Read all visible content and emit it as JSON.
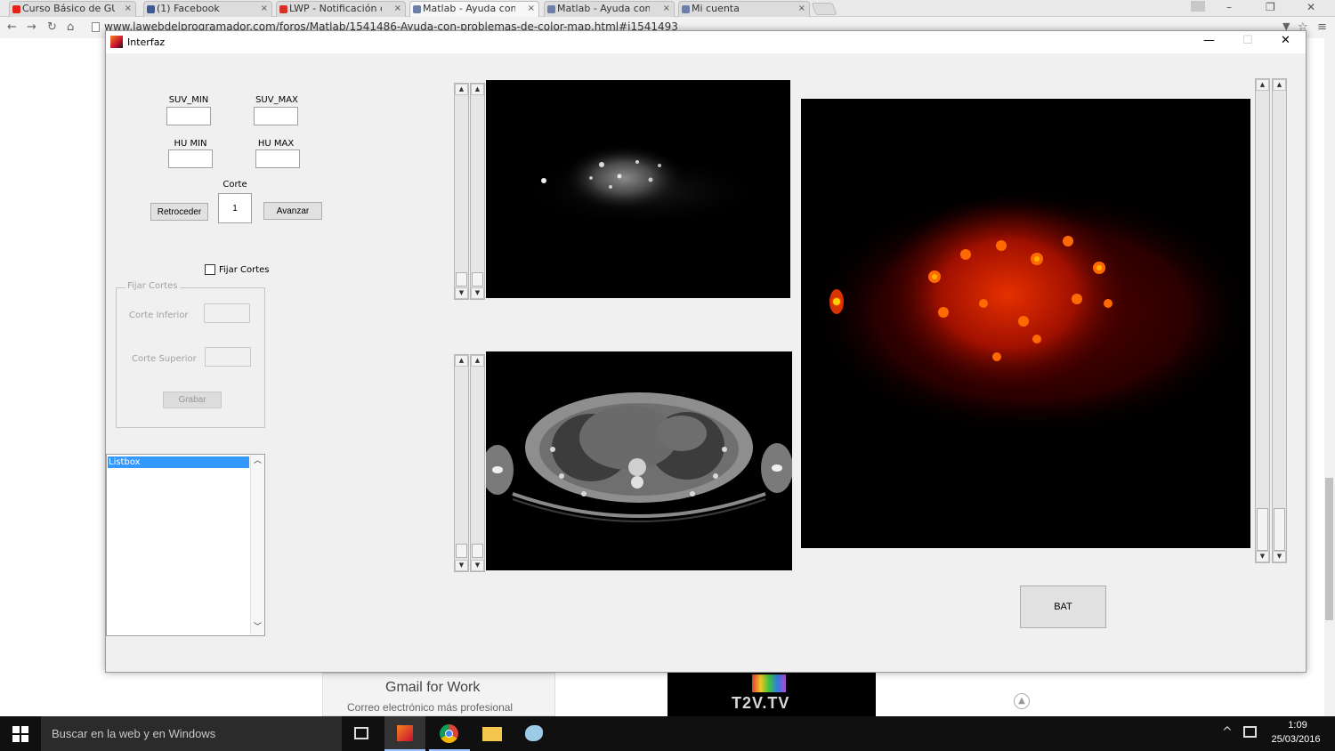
{
  "browser": {
    "tabs": [
      {
        "title": "Curso Básico de GUI",
        "favicon_color": "#e62117"
      },
      {
        "title": "(1) Facebook",
        "favicon_color": "#3b5998"
      },
      {
        "title": "LWP - Notificación d",
        "favicon_color": "#d93025"
      },
      {
        "title": "Matlab - Ayuda con",
        "favicon_color": "#6d7fa8"
      },
      {
        "title": "Matlab - Ayuda con",
        "favicon_color": "#6d7fa8"
      },
      {
        "title": "Mi cuenta",
        "favicon_color": "#6d7fa8"
      }
    ],
    "close_glyph": "×",
    "url": "www.lawebdelprogramador.com/foros/Matlab/1541486-Ayuda-con-problemas-de-color-map.html#i1541493"
  },
  "figure": {
    "title": "Interfaz",
    "suv_min_label": "SUV_MIN",
    "suv_max_label": "SUV_MAX",
    "suv_min_value": "",
    "suv_max_value": "",
    "hu_min_label": "HU MIN",
    "hu_max_label": "HU MAX",
    "hu_min_value": "",
    "hu_max_value": "",
    "corte_label": "Corte",
    "corte_value": "1",
    "retroceder_label": "Retroceder",
    "avanzar_label": "Avanzar",
    "fijar_cortes_checkbox_label": "Fijar Cortes",
    "fijar_cortes_checked": false,
    "group_title": "Fijar Cortes",
    "corte_inferior_label": "Corte Inferior",
    "corte_superior_label": "Corte Superior",
    "corte_inferior_value": "",
    "corte_superior_value": "",
    "grabar_label": "Grabar",
    "listbox_items": [
      "Listbox"
    ],
    "bat_label": "BAT"
  },
  "background_page": {
    "gmail_ad_title": "Gmail for Work",
    "gmail_ad_subtitle": "Correo electrónico más profesional",
    "t2v_logo": "T2V.TV"
  },
  "taskbar": {
    "search_placeholder": "Buscar en la web y en Windows",
    "time": "1:09",
    "date": "25/03/2016"
  },
  "colors": {
    "selection": "#3399ff",
    "figure_bg": "#f0f0f0",
    "taskbar_bg": "#101010"
  }
}
